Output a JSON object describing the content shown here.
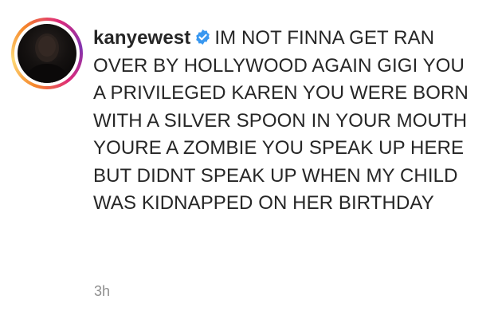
{
  "comment": {
    "username": "kanyewest",
    "verified": true,
    "text": "IM NOT FINNA GET RAN OVER BY HOLLYWOOD AGAIN GIGI YOU A PRIVILEGED KAREN YOU WERE BORN WITH A SILVER SPOON IN YOUR MOUTH YOURE A ZOMBIE YOU SPEAK UP HERE BUT DIDNT SPEAK UP WHEN MY CHILD WAS KIDNAPPED ON HER BIRTHDAY",
    "timestamp": "3h"
  },
  "icons": {
    "verified_badge": "verified-badge-icon",
    "avatar": "profile-avatar"
  },
  "colors": {
    "text": "#262626",
    "muted": "#8e8e8e",
    "verified_blue": "#3897f0"
  }
}
